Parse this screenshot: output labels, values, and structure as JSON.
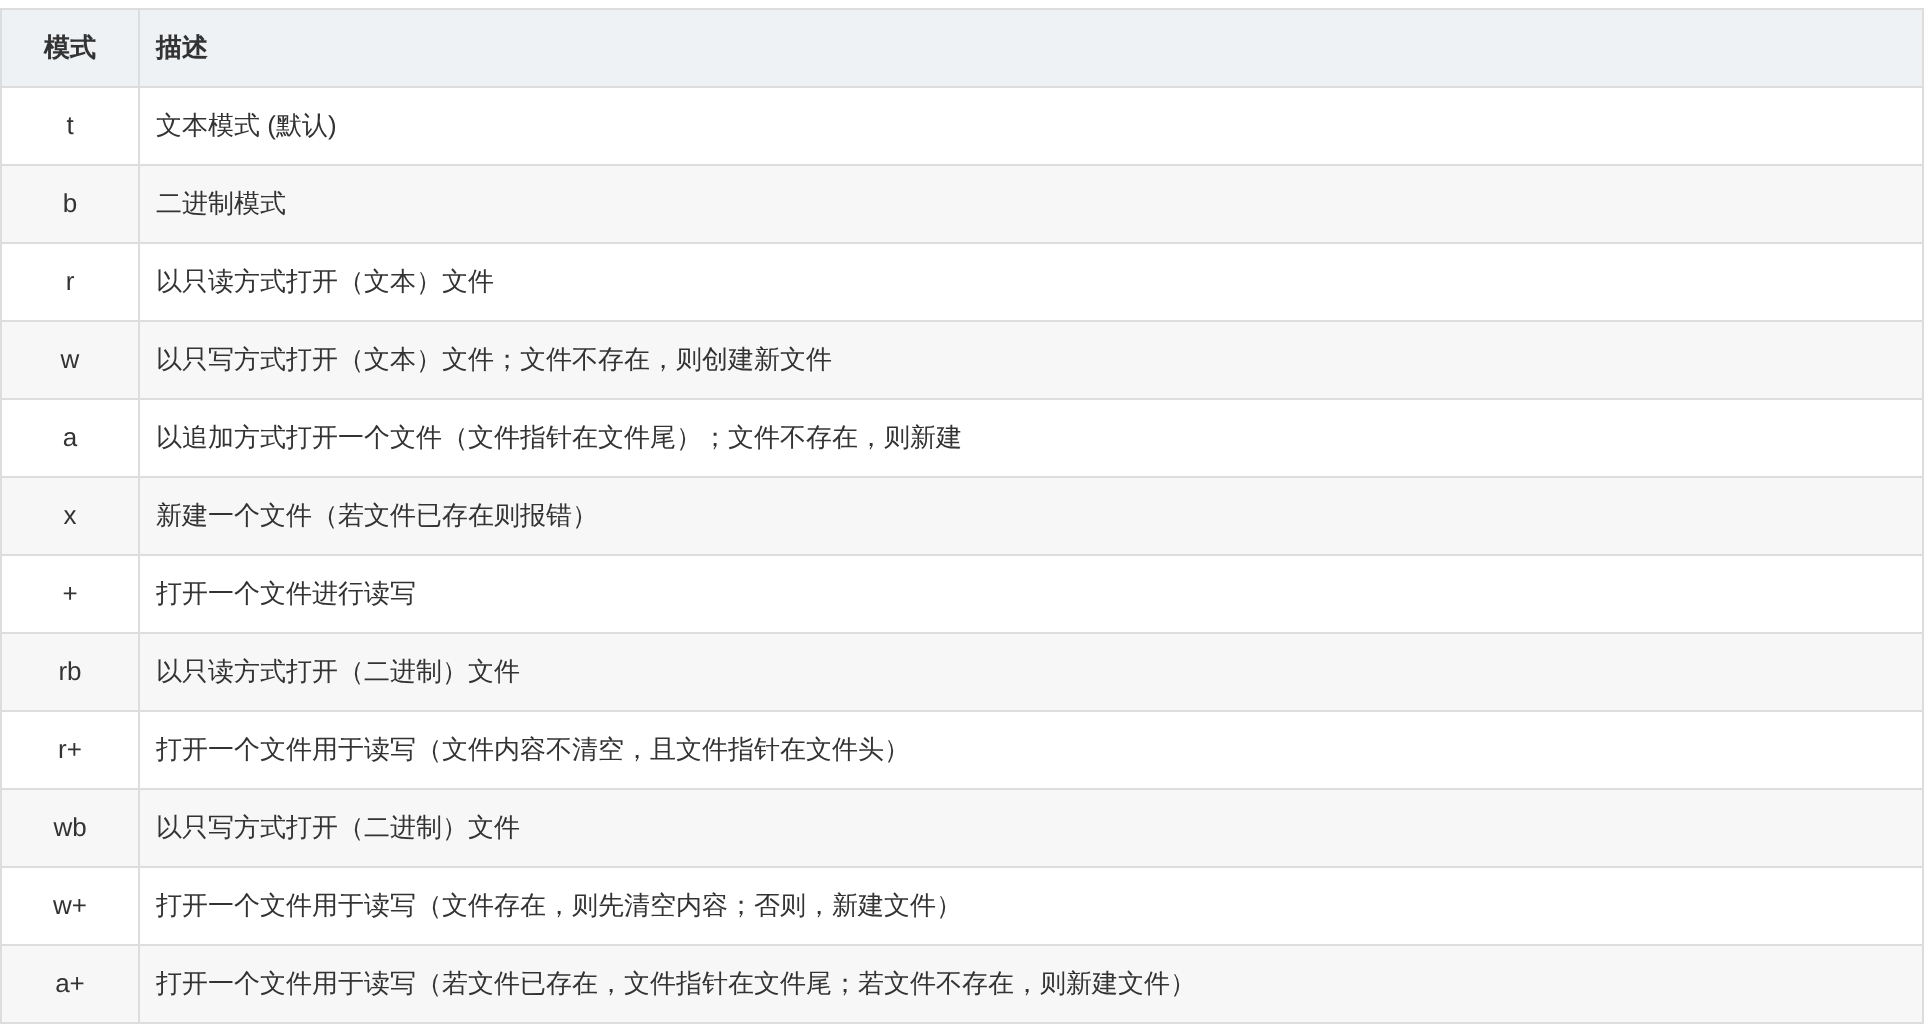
{
  "table": {
    "columns": [
      "模式",
      "描述"
    ],
    "rows": [
      [
        "t",
        "文本模式 (默认)"
      ],
      [
        "b",
        "二进制模式"
      ],
      [
        "r",
        "以只读方式打开（文本）文件"
      ],
      [
        "w",
        "以只写方式打开（文本）文件；文件不存在，则创建新文件"
      ],
      [
        "a",
        "以追加方式打开一个文件（文件指针在文件尾）；文件不存在，则新建"
      ],
      [
        "x",
        "新建一个文件（若文件已存在则报错）"
      ],
      [
        "+",
        "打开一个文件进行读写"
      ],
      [
        "rb",
        "以只读方式打开（二进制）文件"
      ],
      [
        "r+",
        "打开一个文件用于读写（文件内容不清空，且文件指针在文件头）"
      ],
      [
        "wb",
        "以只写方式打开（二进制）文件"
      ],
      [
        "w+",
        "打开一个文件用于读写（文件存在，则先清空内容；否则，新建文件）"
      ],
      [
        "a+",
        "打开一个文件用于读写（若文件已存在，文件指针在文件尾；若文件不存在，则新建文件）"
      ]
    ]
  }
}
